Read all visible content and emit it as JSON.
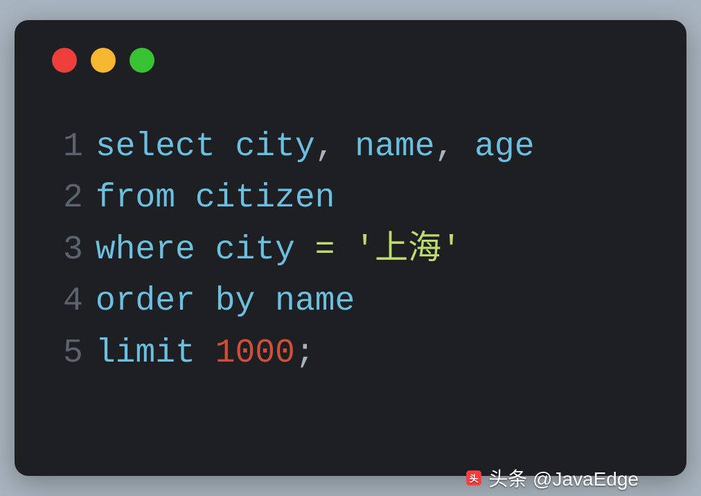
{
  "code": {
    "lines": [
      {
        "num": "1",
        "tokens": [
          {
            "cls": "kw-select",
            "text": "select "
          },
          {
            "cls": "kw-select",
            "text": "city"
          },
          {
            "cls": "comma",
            "text": ", "
          },
          {
            "cls": "kw-select",
            "text": "name"
          },
          {
            "cls": "comma",
            "text": ", "
          },
          {
            "cls": "kw-select",
            "text": "age"
          }
        ]
      },
      {
        "num": "2",
        "tokens": [
          {
            "cls": "kw-from",
            "text": "from citizen"
          }
        ]
      },
      {
        "num": "3",
        "tokens": [
          {
            "cls": "kw-where",
            "text": "where city "
          },
          {
            "cls": "op-equals",
            "text": "="
          },
          {
            "cls": "kw-where",
            "text": " "
          },
          {
            "cls": "str",
            "text": "'上海'"
          }
        ]
      },
      {
        "num": "4",
        "tokens": [
          {
            "cls": "kw-orderby",
            "text": "order by name"
          }
        ]
      },
      {
        "num": "5",
        "tokens": [
          {
            "cls": "kw-limit",
            "text": "limit "
          },
          {
            "cls": "num",
            "text": "1000"
          },
          {
            "cls": "semi",
            "text": ";"
          }
        ]
      }
    ]
  },
  "watermark": {
    "text": "头条 @JavaEdge"
  },
  "colors": {
    "background": "#a8b4be",
    "terminal": "#1d1f23",
    "keyword": "#6dbfe0",
    "string": "#bedc6d",
    "number": "#cf4f3a",
    "lineNumber": "#5b6370"
  }
}
